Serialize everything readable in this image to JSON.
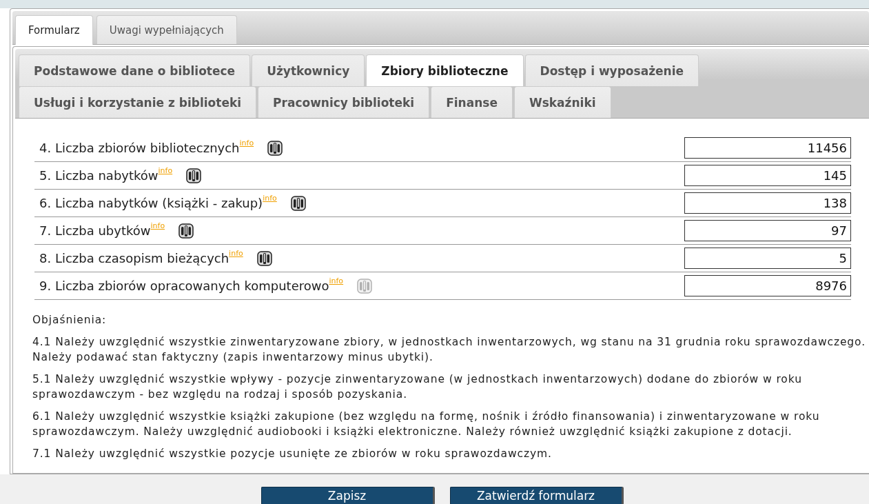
{
  "outer_tabs": [
    {
      "label": "Formularz",
      "selected": true
    },
    {
      "label": "Uwagi wypełniających",
      "selected": false
    }
  ],
  "section_tab_rows": [
    {
      "tabs": [
        {
          "label": "Podstawowe dane o bibliotece",
          "selected": false
        },
        {
          "label": "Użytkownicy",
          "selected": false
        },
        {
          "label": "Zbiory biblioteczne",
          "selected": true
        },
        {
          "label": "Dostęp i wyposażenie",
          "selected": false
        }
      ]
    },
    {
      "tabs": [
        {
          "label": "Usługi i korzystanie z biblioteki",
          "selected": false
        },
        {
          "label": "Pracownicy biblioteki",
          "selected": false
        },
        {
          "label": "Finanse",
          "selected": false
        },
        {
          "label": "Wskaźniki",
          "selected": false
        }
      ]
    }
  ],
  "fields": [
    {
      "label": "4. Liczba zbiorów bibliotecznych",
      "info": "info",
      "value": "11456",
      "gus_disabled": false
    },
    {
      "label": "5. Liczba nabytków",
      "info": "info",
      "value": "145",
      "gus_disabled": false
    },
    {
      "label": "6. Liczba nabytków (książki - zakup)",
      "info": "info",
      "value": "138",
      "gus_disabled": false
    },
    {
      "label": "7. Liczba ubytków",
      "info": "info",
      "value": "97",
      "gus_disabled": false
    },
    {
      "label": "8. Liczba czasopism bieżących",
      "info": "info",
      "value": "5",
      "gus_disabled": false
    },
    {
      "label": "9. Liczba zbiorów opracowanych komputerowo",
      "info": "info",
      "value": "8976",
      "gus_disabled": true
    }
  ],
  "notes": {
    "heading": "Objaśnienia:",
    "items": [
      "4.1 Należy uwzględnić wszystkie zinwentaryzowane zbiory, w jednostkach inwentarzowych, wg stanu na 31 grudnia roku sprawozdawczego. Należy podawać stan faktyczny (zapis inwentarzowy minus ubytki).",
      "5.1 Należy uwzględnić wszystkie wpływy - pozycje zinwentaryzowane (w jednostkach inwentarzowych) dodane do zbiorów w roku sprawozdawczym - bez względu na rodzaj i sposób pozyskania.",
      "6.1 Należy uwzględnić wszystkie książki zakupione (bez względu na formę, nośnik i źródło finansowania) i zinwentaryzowane w roku sprawozdawczym. Należy uwzględnić audiobooki i książki elektroniczne. Należy również uwzględnić książki zakupione z dotacji.",
      "7.1 Należy uwzględnić wszystkie pozycje usunięte ze zbiorów w roku sprawozdawczym."
    ]
  },
  "buttons": [
    "Zapisz",
    "Zatwierdź formularz"
  ]
}
